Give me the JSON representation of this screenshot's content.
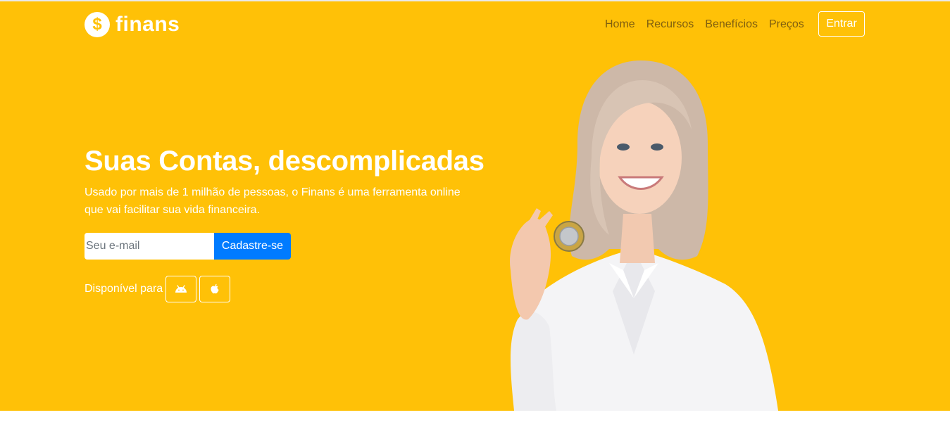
{
  "brand": {
    "name": "finans",
    "icon": "dollar-coin-icon"
  },
  "nav": {
    "items": [
      {
        "label": "Home"
      },
      {
        "label": "Recursos"
      },
      {
        "label": "Benefícios"
      },
      {
        "label": "Preços"
      }
    ],
    "login_label": "Entrar"
  },
  "hero": {
    "headline": "Suas Contas, descomplicadas",
    "lead": "Usado por mais de 1 milhão de pessoas, o Finans é uma ferramenta online que vai facilitar sua vida financeira.",
    "email_placeholder": "Seu e-mail",
    "signup_label": "Cadastre-se",
    "available_label": "Disponível para",
    "platforms": [
      {
        "icon": "android-icon"
      },
      {
        "icon": "apple-icon"
      }
    ]
  },
  "colors": {
    "hero_background": "#ffc107",
    "primary_button": "#007bff",
    "nav_text": "#6b4f11"
  }
}
